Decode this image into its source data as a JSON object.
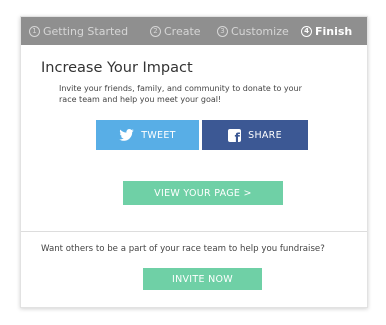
{
  "steps": [
    {
      "number": "1",
      "label": "Getting Started"
    },
    {
      "number": "2",
      "label": "Create"
    },
    {
      "number": "3",
      "label": "Customize"
    },
    {
      "number": "4",
      "label": "Finish"
    }
  ],
  "main": {
    "title": "Increase Your Impact",
    "description": "Invite your friends, family, and community to donate to your race team and help you meet your goal!",
    "tweet_label": "TWEET",
    "share_label": "SHARE",
    "view_page_label": "VIEW YOUR PAGE >",
    "invite_question": "Want others to be a part of your race team to help you fundraise?",
    "invite_label": "INVITE NOW"
  },
  "colors": {
    "twitter": "#58aee6",
    "facebook": "#3c5894",
    "accent_green": "#6fd0a6",
    "steps_bar": "#8f8f8f"
  }
}
